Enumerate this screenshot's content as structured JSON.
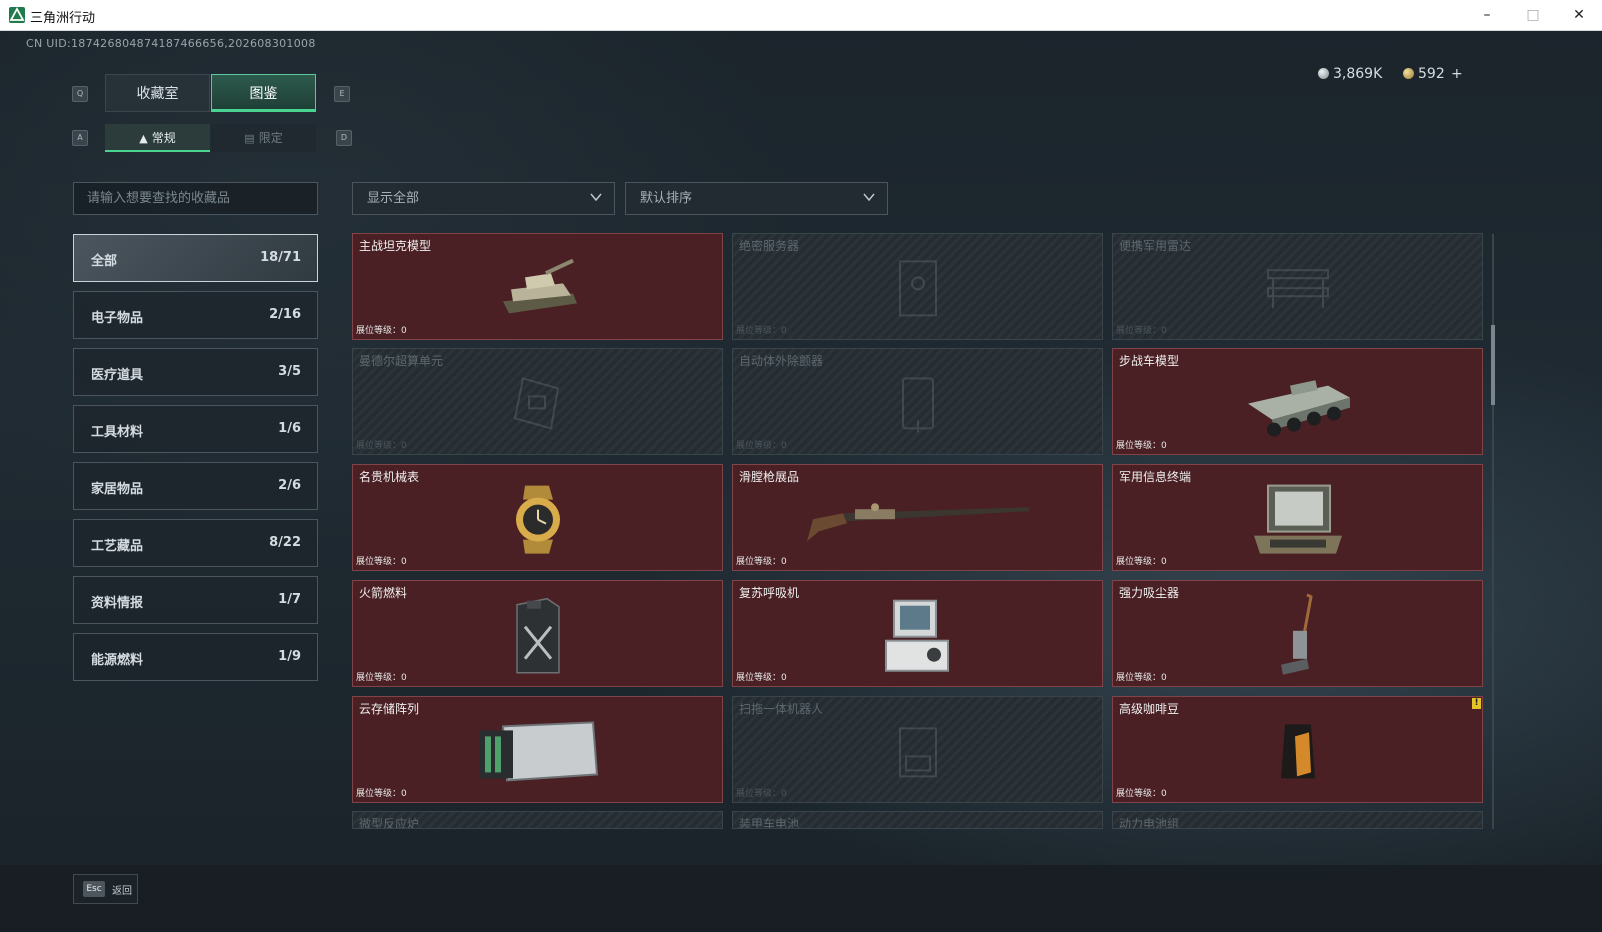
{
  "window": {
    "title": "三角洲行动",
    "min_icon": "minimize-icon",
    "max_icon": "maximize-icon",
    "close_icon": "close-icon"
  },
  "uid_text": "CN UID:187426804874187466656,202608301008",
  "currency": {
    "silver_value": "3,869K",
    "gold_value": "592",
    "add_symbol": "+"
  },
  "tabs": {
    "prev_key": "Q",
    "next_key": "E",
    "main": [
      {
        "label": "收藏室",
        "active": false
      },
      {
        "label": "图鉴",
        "active": true
      }
    ],
    "sub_prev_key": "A",
    "sub_next_key": "D",
    "sub": [
      {
        "label": "常规",
        "icon": "flame-icon",
        "active": true
      },
      {
        "label": "限定",
        "icon": "picture-icon",
        "active": false
      }
    ]
  },
  "search": {
    "placeholder": "请输入想要查找的收藏品"
  },
  "filters": {
    "show": "显示全部",
    "sort": "默认排序"
  },
  "categories": [
    {
      "name": "全部",
      "count": "18/71",
      "active": true
    },
    {
      "name": "电子物品",
      "count": "2/16"
    },
    {
      "name": "医疗道具",
      "count": "3/5"
    },
    {
      "name": "工具材料",
      "count": "1/6"
    },
    {
      "name": "家居物品",
      "count": "2/6"
    },
    {
      "name": "工艺藏品",
      "count": "8/22"
    },
    {
      "name": "资料情报",
      "count": "1/7"
    },
    {
      "name": "能源燃料",
      "count": "1/9"
    }
  ],
  "level_label": "展位等级：",
  "items": [
    {
      "name": "主战坦克模型",
      "level": "0",
      "owned": true,
      "icon": "tank-icon"
    },
    {
      "name": "绝密服务器",
      "level": "0",
      "owned": false,
      "icon": "server-icon"
    },
    {
      "name": "便携军用雷达",
      "level": "0",
      "owned": false,
      "icon": "radar-icon"
    },
    {
      "name": "曼德尔超算单元",
      "level": "0",
      "owned": false,
      "icon": "supercomputer-icon"
    },
    {
      "name": "自动体外除颤器",
      "level": "0",
      "owned": false,
      "icon": "defibrillator-icon"
    },
    {
      "name": "步战车模型",
      "level": "0",
      "owned": true,
      "icon": "ifv-icon"
    },
    {
      "name": "名贵机械表",
      "level": "0",
      "owned": true,
      "icon": "watch-icon"
    },
    {
      "name": "滑膛枪展品",
      "level": "0",
      "owned": true,
      "icon": "musket-icon"
    },
    {
      "name": "军用信息终端",
      "level": "0",
      "owned": true,
      "icon": "terminal-icon"
    },
    {
      "name": "火箭燃料",
      "level": "0",
      "owned": true,
      "icon": "fuel-can-icon"
    },
    {
      "name": "复苏呼吸机",
      "level": "0",
      "owned": true,
      "icon": "ventilator-icon"
    },
    {
      "name": "强力吸尘器",
      "level": "0",
      "owned": true,
      "icon": "vacuum-icon"
    },
    {
      "name": "云存储阵列",
      "level": "0",
      "owned": true,
      "icon": "storage-array-icon"
    },
    {
      "name": "扫拖一体机器人",
      "level": "0",
      "owned": false,
      "icon": "robot-icon"
    },
    {
      "name": "高级咖啡豆",
      "level": "0",
      "owned": true,
      "icon": "coffee-bag-icon",
      "badge": "!"
    }
  ],
  "partial_items": [
    {
      "name": "微型反应炉"
    },
    {
      "name": "装甲车电池"
    },
    {
      "name": "动力电池组"
    }
  ],
  "footer": {
    "esc_key": "Esc",
    "back_label": "返回"
  }
}
